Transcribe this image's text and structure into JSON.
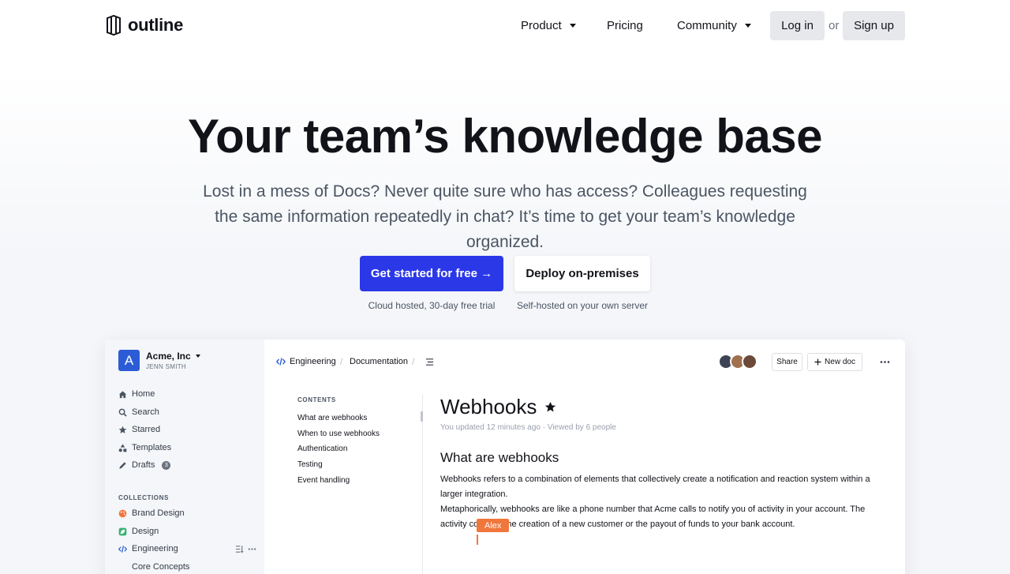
{
  "nav": {
    "logo_text": "outline",
    "product": "Product",
    "pricing": "Pricing",
    "community": "Community",
    "login": "Log in",
    "or": "or",
    "signup": "Sign up"
  },
  "hero": {
    "title": "Your team’s knowledge base",
    "subtitle": "Lost in a mess of Docs? Never quite sure who has access? Colleagues requesting the same information repeatedly in chat? It’s time to get your team’s knowledge organized.",
    "cta_primary": "Get started for free →",
    "cta_primary_note": "Cloud hosted, 30-day free trial",
    "cta_secondary": "Deploy on-premises",
    "cta_secondary_note": "Self-hosted on your own server"
  },
  "app": {
    "team": {
      "initial": "A",
      "name": "Acme, Inc",
      "user": "JENN SMITH"
    },
    "sidebar": [
      {
        "label": "Home",
        "icon": "home-icon"
      },
      {
        "label": "Search",
        "icon": "search-icon"
      },
      {
        "label": "Starred",
        "icon": "star-icon"
      },
      {
        "label": "Templates",
        "icon": "shapes-icon"
      },
      {
        "label": "Drafts",
        "icon": "pencil-icon",
        "badge": "3"
      }
    ],
    "collections_heading": "COLLECTIONS",
    "collections": [
      {
        "label": "Brand Design",
        "color": "#f0763c"
      },
      {
        "label": "Design",
        "color": "#3bb273"
      },
      {
        "label": "Engineering",
        "color": "#2b5cd6"
      }
    ],
    "sub_collection": "Core Concepts",
    "breadcrumb": {
      "collection": "Engineering",
      "doc": "Documentation"
    },
    "share": "Share",
    "new_doc": "New doc",
    "toc": {
      "heading": "CONTENTS",
      "items": [
        "What are webhooks",
        "When to use webhooks",
        "Authentication",
        "Testing",
        "Event handling"
      ]
    },
    "doc": {
      "title": "Webhooks",
      "meta": "You updated 12 minutes ago · Viewed by 6 people",
      "h2": "What are webhooks",
      "p1": "Webhooks refers to a combination of elements that collectively create a notification and reaction system within a larger integration.",
      "p2": "Metaphorically, webhooks are like a phone number that Acme calls to notify you of activity in your account. The activity could be the creation of a new customer or the payout of funds to your bank account.",
      "cursor_user": "Alex"
    },
    "accent": "#2b38e8"
  }
}
